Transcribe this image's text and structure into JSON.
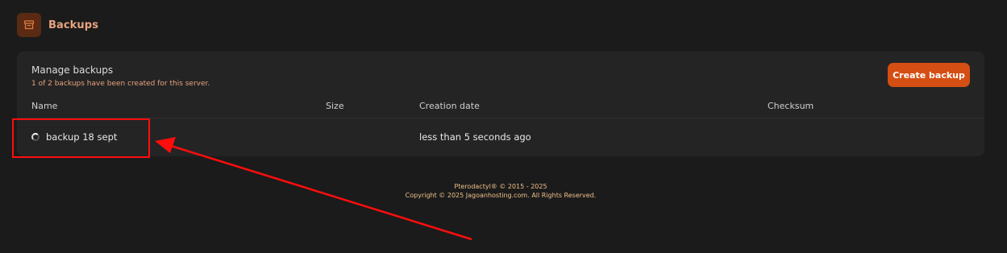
{
  "header": {
    "icon": "archive-icon",
    "title": "Backups"
  },
  "card": {
    "title": "Manage backups",
    "subtitle": "1 of 2 backups have been created for this server.",
    "create_button_label": "Create backup"
  },
  "table": {
    "columns": [
      "Name",
      "Size",
      "Creation date",
      "Checksum"
    ],
    "rows": [
      {
        "status_icon": "loading-spinner-icon",
        "name": "backup 18 sept",
        "size": "",
        "creation_date": "less than 5 seconds ago",
        "checksum": ""
      }
    ]
  },
  "footer": {
    "line1": "Pterodactyl® © 2015 - 2025",
    "line2": "Copyright © 2025 Jagoanhosting.com. All Rights Reserved."
  },
  "colors": {
    "background": "#1b1b1b",
    "card": "#242424",
    "accent": "#d54e13",
    "accent_text": "#e8a37f",
    "annotation": "#ff0d0d"
  },
  "annotation": {
    "type": "red-box-with-arrow",
    "target": "backup 18 sept"
  }
}
